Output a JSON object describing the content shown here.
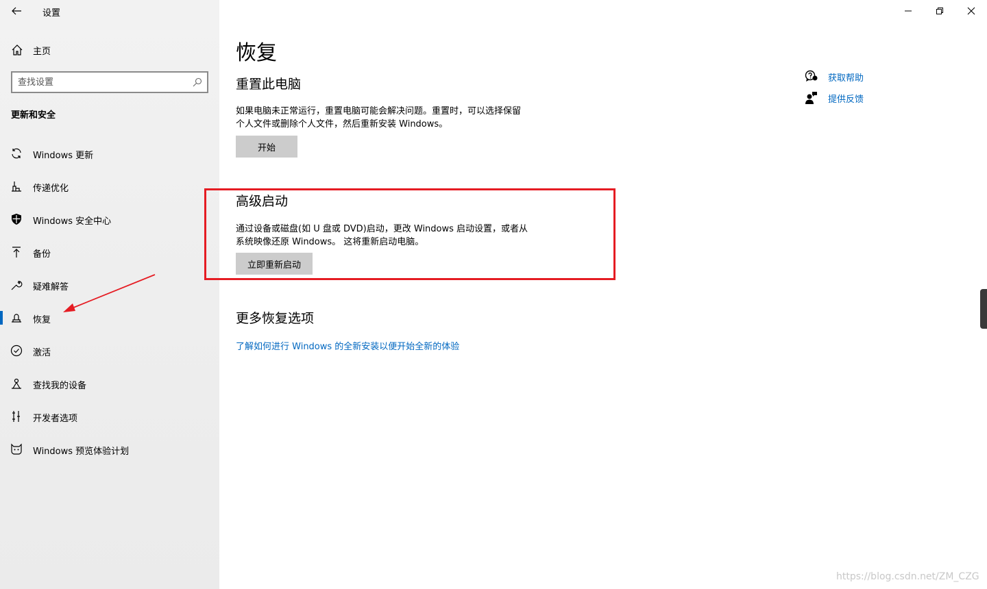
{
  "window": {
    "title": "设置",
    "controls": {
      "minimize": "minimize-icon",
      "maximize": "restore-icon",
      "close": "close-icon"
    }
  },
  "sidebar": {
    "home_label": "主页",
    "search_placeholder": "查找设置",
    "section_title": "更新和安全",
    "items": [
      {
        "label": "Windows 更新",
        "icon": "sync-icon"
      },
      {
        "label": "传递优化",
        "icon": "delivery-optimization-icon"
      },
      {
        "label": "Windows 安全中心",
        "icon": "shield-icon"
      },
      {
        "label": "备份",
        "icon": "backup-icon"
      },
      {
        "label": "疑难解答",
        "icon": "wrench-icon"
      },
      {
        "label": "恢复",
        "icon": "recovery-icon",
        "active": true
      },
      {
        "label": "激活",
        "icon": "check-circle-icon"
      },
      {
        "label": "查找我的设备",
        "icon": "find-device-icon"
      },
      {
        "label": "开发者选项",
        "icon": "developer-icon"
      },
      {
        "label": "Windows 预览体验计划",
        "icon": "insider-cat-icon"
      }
    ]
  },
  "main": {
    "page_title": "恢复",
    "reset": {
      "title": "重置此电脑",
      "description_line1": "如果电脑未正常运行，重置电脑可能会解决问题。重置时，可以选择保留",
      "description_line2": "个人文件或删除个人文件，然后重新安装 Windows。",
      "button": "开始"
    },
    "advanced": {
      "title": "高级启动",
      "description_line1": "通过设备或磁盘(如 U 盘或 DVD)启动，更改 Windows 启动设置，或者从",
      "description_line2": "系统映像还原 Windows。 这将重新启动电脑。",
      "button": "立即重新启动"
    },
    "more": {
      "title": "更多恢复选项",
      "link": "了解如何进行 Windows 的全新安装以便开始全新的体验"
    },
    "help": {
      "get_help": "获取帮助",
      "feedback": "提供反馈"
    }
  },
  "watermark": "https://blog.csdn.net/ZM_CZG",
  "colors": {
    "accent": "#0067c0",
    "annotation": "#e51c23",
    "button_bg": "#cccccc"
  }
}
